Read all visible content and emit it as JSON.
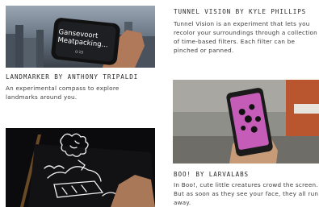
{
  "article": {
    "items": [
      {
        "image": {
          "overlay_title": "Gansevoort\nMeatpacking...",
          "overlay_sub": "0:15"
        },
        "title": "LANDMARKER BY ANTHONY TRIPALDI",
        "description": "An experimental compass to explore landmarks around you."
      },
      {
        "title": "TUNNEL VISION BY KYLE PHILLIPS",
        "description": "Tunnel Vision is an experiment that lets you recolor your surroundings through a collection of time-based filters. Each filter can be pinched or panned."
      },
      {
        "title": "BOO! BY LARVALABS",
        "description": "In Boo!, cute little creatures crowd the screen. But as soon as they see your face, they all run away."
      },
      {
        "image_icon": "glowing-sketch-illustration"
      }
    ]
  },
  "colors": {
    "accent": "#2a2a2a",
    "phone_screen_pink": "#c55db8"
  }
}
